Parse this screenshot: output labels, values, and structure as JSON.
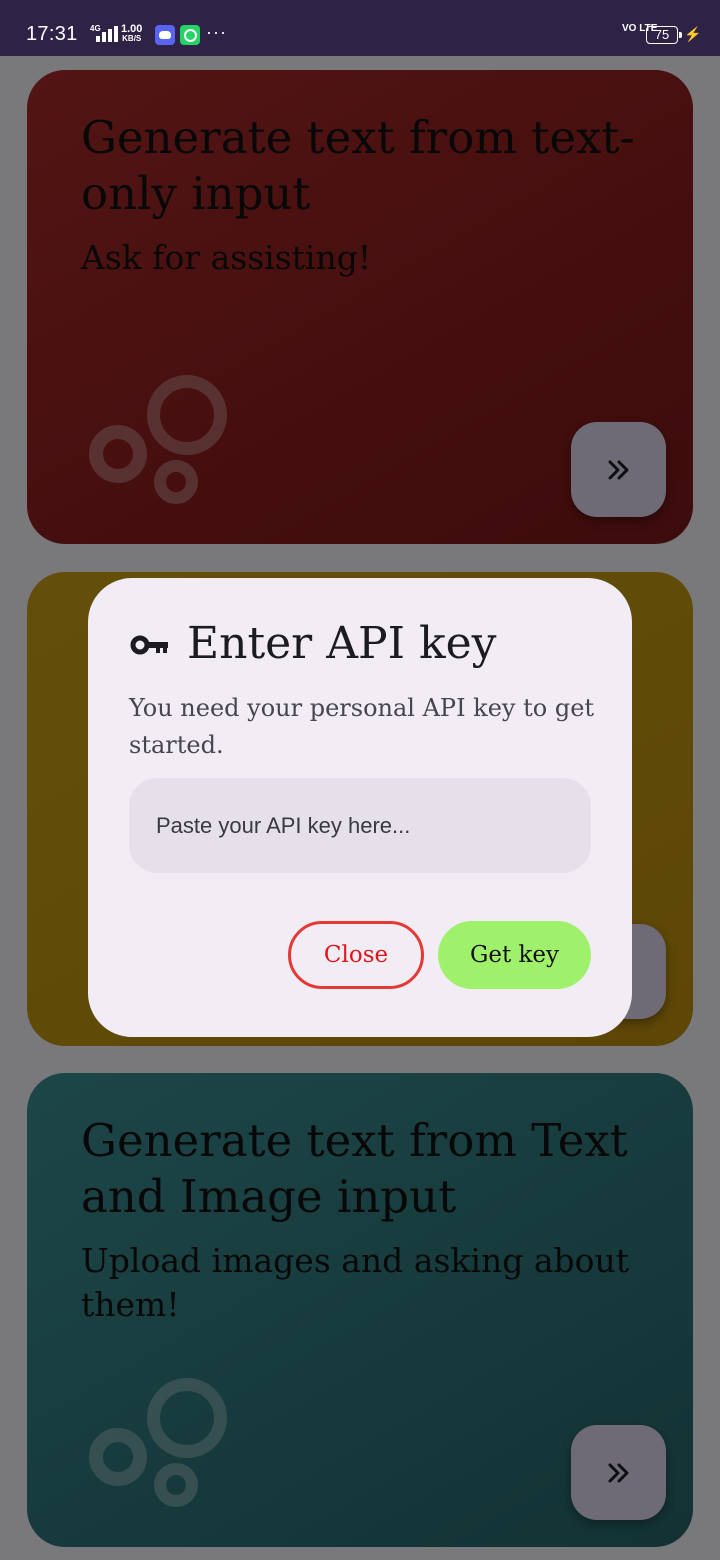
{
  "status_bar": {
    "time": "17:31",
    "network": "4G",
    "speed_value": "1.00",
    "speed_unit": "KB/S",
    "more": "···",
    "volte": "VO LTE",
    "battery": "75",
    "icons": [
      "signal-icon",
      "discord-icon",
      "whatsapp-icon",
      "charging-icon"
    ]
  },
  "cards": [
    {
      "title": "Generate text from text-only input",
      "subtitle": "Ask for assisting!",
      "color": "#8b1d1d"
    },
    {
      "title": "",
      "subtitle": "",
      "color": "#bb8c0d"
    },
    {
      "title": "Generate text from Text and Image input",
      "subtitle": "Upload images and asking about them!",
      "color": "#2d7478"
    }
  ],
  "dialog": {
    "icon": "key-icon",
    "title": "Enter API key",
    "body": "You need your personal API key to get started.",
    "input_placeholder": "Paste your API key here...",
    "input_value": "",
    "close_label": "Close",
    "get_key_label": "Get key",
    "accent_close": "#e53935",
    "accent_get_key": "#9ff06a"
  }
}
